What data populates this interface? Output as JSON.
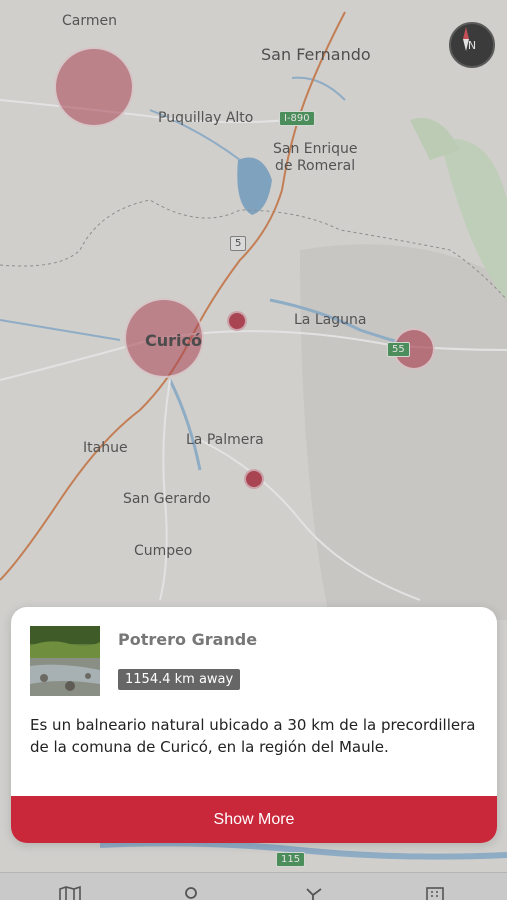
{
  "map": {
    "places": {
      "carmen": "Carmen",
      "san_fernando": "San Fernando",
      "puquillay_alto": "Puquillay Alto",
      "san_enrique_line1": "San Enrique",
      "san_enrique_line2": "de Romeral",
      "la_laguna": "La Laguna",
      "curico": "Curicó",
      "itahue": "Itahue",
      "la_palmera": "La Palmera",
      "san_gerardo": "San Gerardo",
      "cumpeo": "Cumpeo"
    },
    "roads": {
      "i890": "I-890",
      "r5": "5",
      "r55": "55",
      "r115": "115"
    },
    "compass_label": "N",
    "colors": {
      "marker": "#b0243a",
      "road": "#d4753c",
      "water": "#6f9fc9",
      "green": "#8fc28f"
    }
  },
  "card": {
    "title": "Potrero Grande",
    "distance": "1154.4 km away",
    "description": "Es un balneario natural ubicado a 30 km de la precordillera de la comuna de Curicó, en la región del Maule.",
    "show_more_label": "Show More",
    "accent_color": "#c8283a"
  },
  "tabbar": {
    "icons": [
      "map-icon",
      "search-icon",
      "route-icon",
      "list-icon"
    ]
  }
}
